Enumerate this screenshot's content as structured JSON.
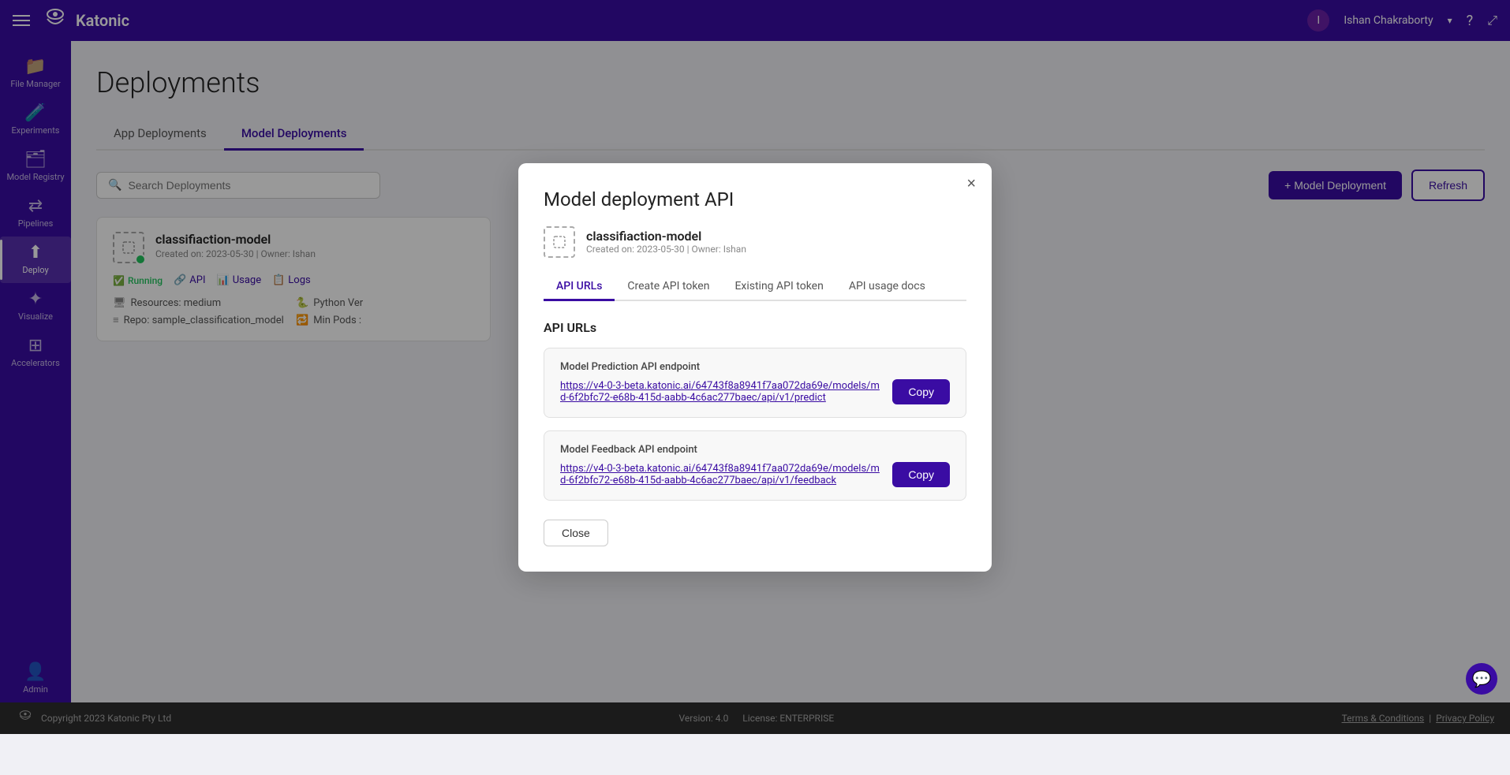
{
  "topnav": {
    "logo_text": "Katonic",
    "user_name": "Ishan Chakraborty",
    "help_label": "help"
  },
  "sidebar": {
    "items": [
      {
        "id": "file-manager",
        "label": "File Manager",
        "icon": "📁"
      },
      {
        "id": "experiments",
        "label": "Experiments",
        "icon": "🧪"
      },
      {
        "id": "model-registry",
        "label": "Model Registry",
        "icon": "🗂"
      },
      {
        "id": "pipelines",
        "label": "Pipelines",
        "icon": "⟳"
      },
      {
        "id": "deploy",
        "label": "Deploy",
        "icon": "⬆",
        "active": true
      },
      {
        "id": "visualize",
        "label": "Visualize",
        "icon": "✦"
      },
      {
        "id": "accelerators",
        "label": "Accelerators",
        "icon": "⊞"
      },
      {
        "id": "admin",
        "label": "Admin",
        "icon": "👤"
      }
    ]
  },
  "page": {
    "title": "Deployments"
  },
  "tabs": [
    {
      "id": "app-deployments",
      "label": "App Deployments",
      "active": false
    },
    {
      "id": "model-deployments",
      "label": "Model Deployments",
      "active": true
    }
  ],
  "search": {
    "placeholder": "Search Deployments"
  },
  "toolbar": {
    "add_button_label": "+ Model Deployment",
    "refresh_button_label": "Refresh"
  },
  "deployment_card": {
    "name": "classiﬁaction-model",
    "created_on": "2023-05-30",
    "owner": "Ishan",
    "meta": "Created on: 2023-05-30 | Owner: Ishan",
    "status": "Running",
    "api_label": "API",
    "usage_label": "Usage",
    "logs_label": "Logs",
    "resources_label": "Resources: medium",
    "repo_label": "Repo: sample_classification_model",
    "python_ver_label": "Python Ver",
    "min_pods_label": "Min Pods :"
  },
  "modal": {
    "title": "Model deployment API",
    "model_name": "classiﬁaction-model",
    "model_meta": "Created on: 2023-05-30 | Owner: Ishan",
    "tabs": [
      {
        "id": "api-urls",
        "label": "API URLs",
        "active": true
      },
      {
        "id": "create-api-token",
        "label": "Create API token",
        "active": false
      },
      {
        "id": "existing-api-token",
        "label": "Existing API token",
        "active": false
      },
      {
        "id": "api-usage-docs",
        "label": "API usage docs",
        "active": false
      }
    ],
    "section_title": "API URLs",
    "prediction_endpoint": {
      "label": "Model Prediction API endpoint",
      "url": "https://v4-0-3-beta.katonic.ai/64743f8a8941f7aa072da69e/models/md-6f2bfc72-e68b-415d-aabb-4c6ac277baec/api/v1/predict",
      "copy_label": "Copy"
    },
    "feedback_endpoint": {
      "label": "Model Feedback API endpoint",
      "url": "https://v4-0-3-beta.katonic.ai/64743f8a8941f7aa072da69e/models/md-6f2bfc72-e68b-415d-aabb-4c6ac277baec/api/v1/feedback",
      "copy_label": "Copy"
    },
    "close_label": "Close"
  },
  "footer": {
    "copyright": "Copyright 2023 Katonic Pty Ltd",
    "version": "Version: 4.0",
    "license": "License: ENTERPRISE",
    "terms_label": "Terms & Conditions",
    "privacy_label": "Privacy Policy",
    "separator": "|"
  }
}
